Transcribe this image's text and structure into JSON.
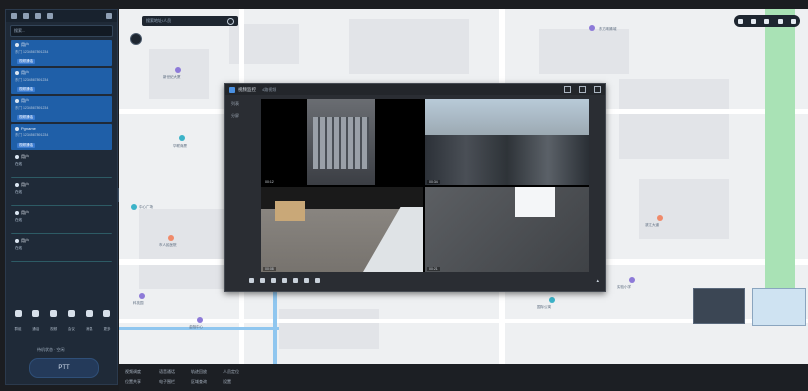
{
  "sidebar": {
    "search_placeholder": "搜索...",
    "contacts": [
      {
        "name": "用户",
        "sub": "东门 1234567891234",
        "badge": "视频通话",
        "active": true
      },
      {
        "name": "用户",
        "sub": "东门 1234567891234",
        "badge": "视频通话",
        "active": true
      },
      {
        "name": "用户",
        "sub": "东门 1234567891234",
        "badge": "视频通话",
        "active": true
      },
      {
        "name": "Pgname",
        "sub": "东门 1234567891234",
        "badge": "视频通话",
        "active": true
      },
      {
        "name": "用户",
        "sub": "在线",
        "badge": "",
        "active": false
      },
      {
        "name": "用户",
        "sub": "在线",
        "badge": "",
        "active": false
      },
      {
        "name": "用户",
        "sub": "在线",
        "badge": "",
        "active": false
      },
      {
        "name": "用户",
        "sub": "在线",
        "badge": "",
        "active": false
      }
    ],
    "tools": [
      "群组",
      "通话",
      "视频",
      "会议",
      "消息",
      "更多"
    ],
    "ptt_status": "待机状态 · 空闲",
    "ptt_label": "PTT"
  },
  "map": {
    "search_placeholder": "搜索地址/人员",
    "labels": [
      "新世纪大厦",
      "华联商厦",
      "中心广场",
      "市人民医院",
      "东方明珠城",
      "滨江大道",
      "实验小学",
      "国际公寓",
      "金融中心",
      "科技园"
    ]
  },
  "video_window": {
    "title": "视频监控",
    "subtitle": "4路视频",
    "side_items": [
      "列表",
      "分屏"
    ],
    "timestamps": [
      "00:12",
      "00:34",
      "00:08",
      "00:21"
    ]
  },
  "bottom_bar": {
    "items": [
      "视频调度",
      "语音通话",
      "轨迹回放",
      "人员定位",
      "位置共享",
      "电子围栏",
      "区域查询",
      "设置"
    ]
  }
}
